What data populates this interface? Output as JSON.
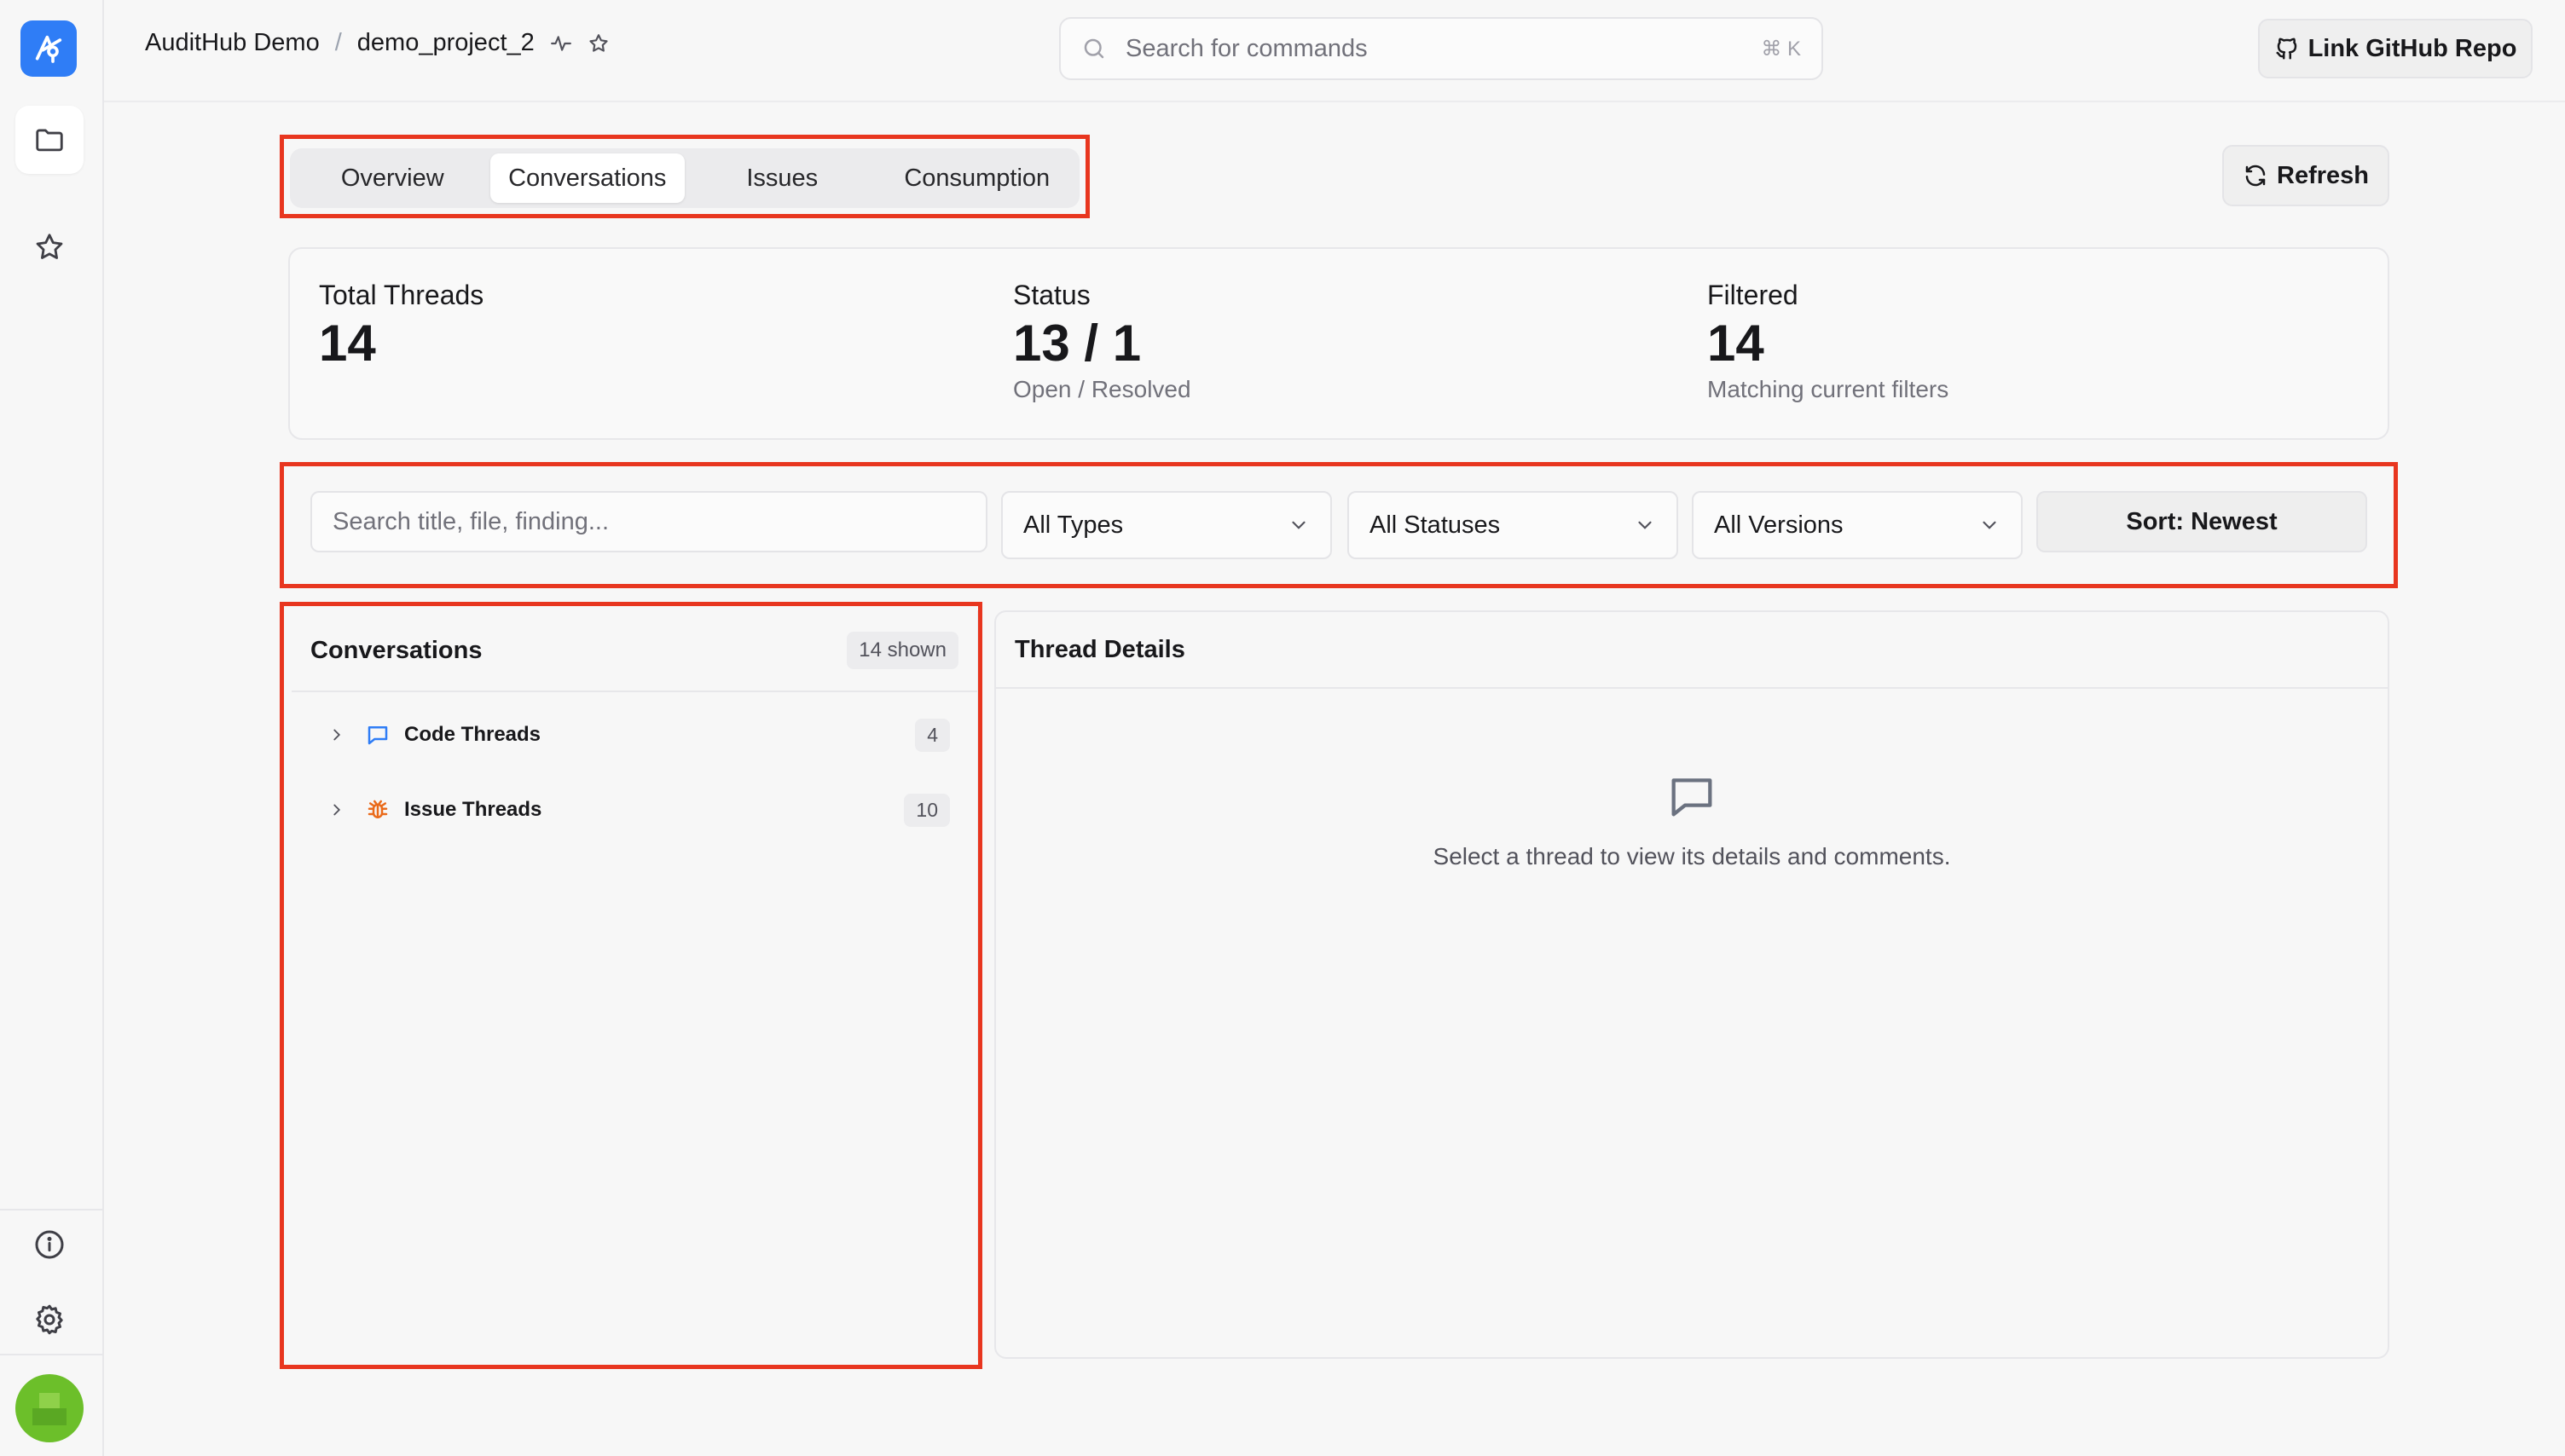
{
  "header": {
    "org": "AuditHub Demo",
    "separator": "/",
    "project": "demo_project_2",
    "search_placeholder": "Search for commands",
    "search_shortcut": "⌘ K",
    "link_repo_label": "Link GitHub Repo"
  },
  "tabs": [
    {
      "label": "Overview",
      "active": false
    },
    {
      "label": "Conversations",
      "active": true
    },
    {
      "label": "Issues",
      "active": false
    },
    {
      "label": "Consumption",
      "active": false
    }
  ],
  "refresh_label": "Refresh",
  "stats": {
    "total": {
      "label": "Total Threads",
      "value": "14"
    },
    "status": {
      "label": "Status",
      "value": "13 / 1",
      "sub": "Open / Resolved"
    },
    "filtered": {
      "label": "Filtered",
      "value": "14",
      "sub": "Matching current filters"
    }
  },
  "filters": {
    "search_placeholder": "Search title, file, finding...",
    "types": "All Types",
    "statuses": "All Statuses",
    "versions": "All Versions",
    "sort": "Sort: Newest"
  },
  "conversations": {
    "title": "Conversations",
    "shown": "14 shown",
    "groups": [
      {
        "label": "Code Threads",
        "count": "4",
        "icon": "message-icon",
        "color": "#2f7df6"
      },
      {
        "label": "Issue Threads",
        "count": "10",
        "icon": "bug-icon",
        "color": "#ea6a1a"
      }
    ]
  },
  "details": {
    "title": "Thread Details",
    "empty_message": "Select a thread to view its details and comments."
  },
  "colors": {
    "accent": "#2f7df6",
    "highlight": "#e8361f",
    "avatar": "#6cbf2a"
  }
}
